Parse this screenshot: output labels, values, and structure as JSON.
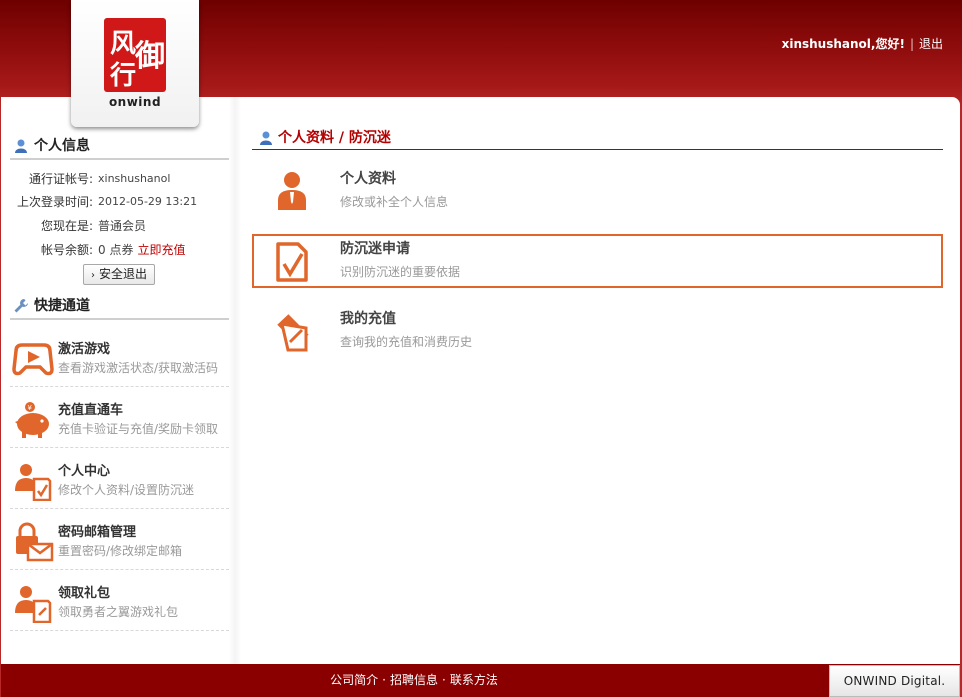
{
  "header": {
    "logo_text": "onwind",
    "logo_seal_chars": [
      "风",
      "行",
      "御"
    ],
    "username": "xinshushanol,您好!",
    "separator": "|",
    "logout": "退出"
  },
  "sidebar": {
    "info_title": "个人信息",
    "info": [
      {
        "label": "通行证帐号:",
        "value": "xinshushanol"
      },
      {
        "label": "上次登录时间:",
        "value": "2012-05-29 13:21"
      },
      {
        "label": "您现在是:",
        "value": "普通会员"
      },
      {
        "label": "帐号余额:",
        "value": "0 点券",
        "link": "立即充值"
      }
    ],
    "logout_button": "安全退出",
    "quick_title": "快捷通道",
    "quick": [
      {
        "name": "激活游戏",
        "desc": "查看游戏激活状态/获取激活码",
        "icon": "gamepad-icon"
      },
      {
        "name": "充值直通车",
        "desc": "充值卡验证与充值/奖励卡领取",
        "icon": "piggy-bank-icon"
      },
      {
        "name": "个人中心",
        "desc": "修改个人资料/设置防沉迷",
        "icon": "user-document-icon"
      },
      {
        "name": "密码邮箱管理",
        "desc": "重置密码/修改绑定邮箱",
        "icon": "lock-mail-icon"
      },
      {
        "name": "领取礼包",
        "desc": "领取勇者之翼游戏礼包",
        "icon": "user-gift-icon"
      }
    ]
  },
  "main": {
    "title": "个人资料 / 防沉迷",
    "cards": [
      {
        "name": "个人资料",
        "desc": "修改或补全个人信息",
        "icon": "user-icon"
      },
      {
        "name": "防沉迷申请",
        "desc": "识别防沉迷的重要依据",
        "icon": "document-check-icon",
        "active": true
      },
      {
        "name": "我的充值",
        "desc": "查询我的充值和消费历史",
        "icon": "edit-document-icon"
      }
    ]
  },
  "footer": {
    "links": [
      "公司简介",
      "招聘信息",
      "联系方法"
    ],
    "dot": "·",
    "brand": "ONWIND Digital."
  },
  "colors": {
    "brand_red": "#8a0000",
    "accent_orange": "#e0662b",
    "title_red": "#b40000",
    "link_red": "#c00000"
  }
}
